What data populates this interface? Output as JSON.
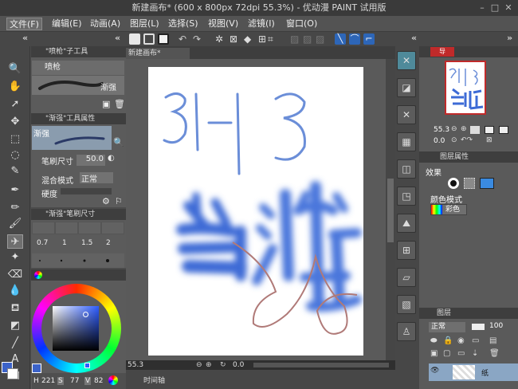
{
  "window": {
    "title": "新建画布* (600 x 800px 72dpi 55.3%) - 优动漫 PAINT 试用版",
    "minimize": "–",
    "maximize": "□",
    "close": "✕"
  },
  "menu": [
    "文件(F)",
    "编辑(E)",
    "动画(A)",
    "图层(L)",
    "选择(S)",
    "视图(V)",
    "滤镜(I)",
    "窗口(O)"
  ],
  "subtool_panel": {
    "title": "\"喷枪\"子工具",
    "items": [
      "喷枪",
      "渐强"
    ]
  },
  "tool_property": {
    "title": "\"渐强\"工具属性",
    "tool_name": "渐强",
    "brush_size_label": "笔刷尺寸",
    "brush_size_value": "50.0",
    "blend_mode_label": "混合模式",
    "blend_mode_value": "正常",
    "partial_label": "硬度"
  },
  "brush_size_panel": {
    "title": "\"渐强\"笔刷尺寸",
    "sizes": [
      "0.7",
      "1",
      "1.5",
      "2"
    ]
  },
  "color_wheel": {
    "h": "221",
    "h_label": "H",
    "s_label": "S",
    "s": "77",
    "v_label": "V",
    "v": "82",
    "main_color": "#3c63c9",
    "sub_color": "#ffffff"
  },
  "canvas": {
    "tab": "新建画布*",
    "zoom": "55.3",
    "rotation": "0.0",
    "sketch_text": "31-13",
    "paint_text": "当游",
    "paint_color": "#3d6bd6",
    "line_color": "#b07a78"
  },
  "timeline": {
    "label": "时间轴"
  },
  "navigator": {
    "tab": "导",
    "zoom": "55.3",
    "rotation": "0.0"
  },
  "layer_property": {
    "title": "图层属性",
    "effect_label": "效果",
    "color_mode_label": "颜色模式",
    "color_mode_value": "彩色"
  },
  "layer_panel": {
    "title": "图层",
    "blend_mode": "正常",
    "opacity": "100",
    "layer_name": "纸"
  }
}
